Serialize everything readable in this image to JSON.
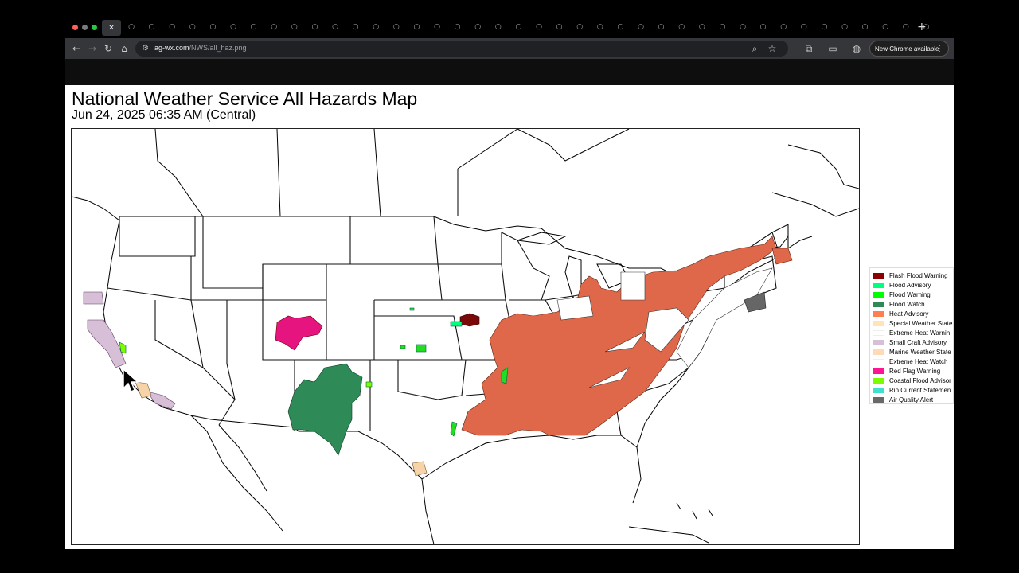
{
  "browser": {
    "active_tab_close": "×",
    "new_tab": "+",
    "url_host": "ag-wx.com",
    "url_path": "/NWS/all_haz.png",
    "update_notice": "New Chrome available",
    "menu_glyph": "⋮"
  },
  "map": {
    "title": "National Weather Service All Hazards Map",
    "subtitle": "Jun 24, 2025 06:35 AM (Central)"
  },
  "legend": [
    {
      "label": "Flash Flood Warning",
      "color": "#8b0000"
    },
    {
      "label": "Flood Advisory",
      "color": "#00ff7f"
    },
    {
      "label": "Flood Warning",
      "color": "#00ff00"
    },
    {
      "label": "Flood Watch",
      "color": "#2e8b57"
    },
    {
      "label": "Heat Advisory",
      "color": "#ff7f50"
    },
    {
      "label": "Special Weather State",
      "color": "#ffe4b5"
    },
    {
      "label": "Extreme Heat Warnin",
      "color": "#ffffff"
    },
    {
      "label": "Small Craft Advisory",
      "color": "#d8bfd8"
    },
    {
      "label": "Marine Weather State",
      "color": "#ffdab9"
    },
    {
      "label": "Extreme Heat Watch",
      "color": "#ffffff"
    },
    {
      "label": "Red Flag Warning",
      "color": "#ff1493"
    },
    {
      "label": "Coastal Flood Advisor",
      "color": "#7cfc00"
    },
    {
      "label": "Rip Current Statemen",
      "color": "#40e0d0"
    },
    {
      "label": "Air Quality Alert",
      "color": "#696969"
    }
  ],
  "colors": {
    "heat_advisory": "#e0684a",
    "flood_watch": "#2e8b57",
    "red_flag": "#e6147f",
    "small_craft": "#d8bfd8",
    "flash_flood": "#7a0a0a",
    "marine": "#f6d3a8",
    "flood_warning": "#22dd22",
    "air_quality": "#666666"
  }
}
